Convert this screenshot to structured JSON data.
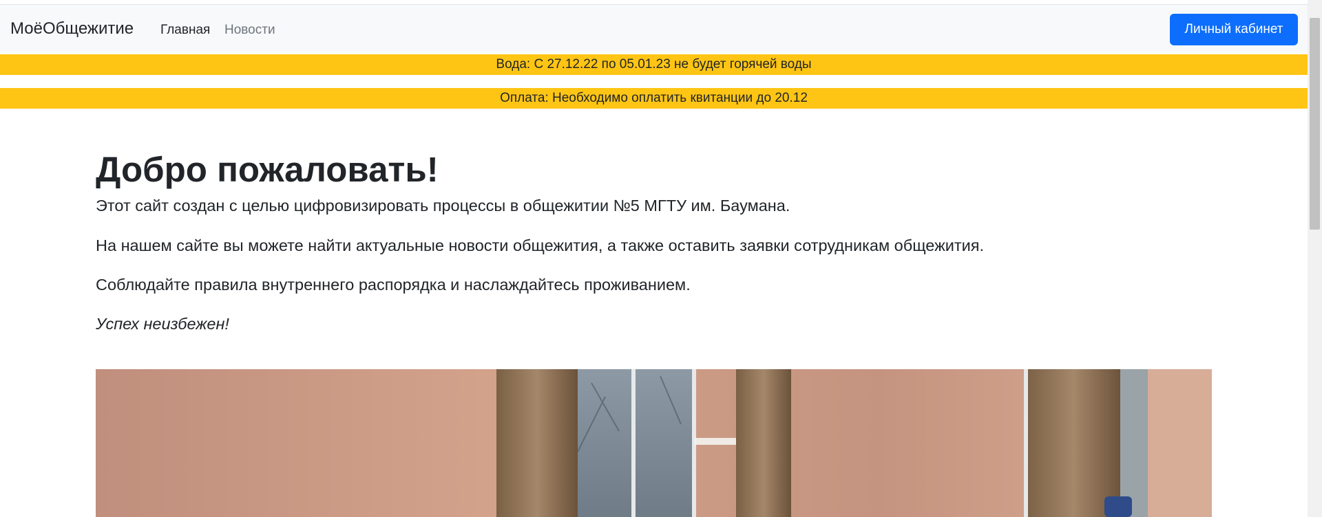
{
  "navbar": {
    "brand": "МоёОбщежитие",
    "links": [
      {
        "label": "Главная",
        "active": true
      },
      {
        "label": "Новости",
        "active": false
      }
    ],
    "cabinet_button": "Личный кабинет"
  },
  "banners": [
    {
      "text": "Вода: С 27.12.22 по 05.01.23 не будет горячей воды"
    },
    {
      "text": "Оплата: Необходимо оплатить квитанции до 20.12"
    }
  ],
  "main": {
    "title": "Добро пожаловать!",
    "paragraphs": [
      "Этот сайт создан с целью цифровизировать процессы в общежитии №5 МГТУ им. Баумана.",
      "На нашем сайте вы можете найти актуальные новости общежития, а также оставить заявки сотрудникам общежития.",
      "Соблюдайте правила внутреннего распорядка и наслаждайтесь проживанием."
    ],
    "motto": "Успех неизбежен!"
  },
  "colors": {
    "accent": "#0d6efd",
    "banner": "#ffc515",
    "navbar_bg": "#f8f9fa"
  }
}
